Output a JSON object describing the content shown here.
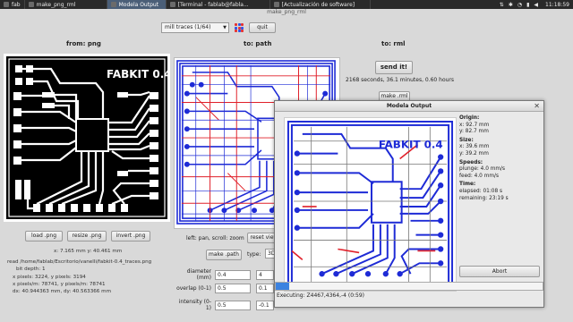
{
  "taskbar": {
    "tasks": [
      {
        "label": "fab",
        "active": false
      },
      {
        "label": "make_png_rml",
        "active": false
      },
      {
        "label": "Modela Output",
        "active": true
      },
      {
        "label": "[Terminal - fablab@fabla...",
        "active": false
      },
      {
        "label": "[Actualización de software]",
        "active": false
      }
    ],
    "clock": "11:18:59"
  },
  "app": {
    "title": "make_png_rml",
    "mode_select": "mill traces (1/64)",
    "quit_label": "quit"
  },
  "left": {
    "title": "from: png",
    "board_label": "FABKIT 0.4",
    "load_label": "load .png",
    "resize_label": "resize .png",
    "invert_label": "invert .png",
    "xy": "x: 7.165 mm  y: 40.461 mm",
    "read_path": "read /home/fablab/Escritorio/vanelli/fabkit-0.4_traces.png",
    "bit_depth": "bit depth: 1",
    "pixels": "x pixels: 3224, y pixels: 3194",
    "ppm": "x pixels/m: 78741, y pixels/m: 78741",
    "dxdy": "dx: 40.944363 mm, dy: 40.563366 mm"
  },
  "middle": {
    "title": "to: path",
    "nav_hint": "left: pan, scroll: zoom",
    "reset_label": "reset view",
    "make_path_label": "make .path",
    "type_label": "type:",
    "type_value": "3D",
    "diameter_label": "diameter (mm)",
    "diameter_value": "0.4",
    "diameter_value2": "4",
    "overlap_label": "overlap (0-1)",
    "overlap_value": "0.5",
    "overlap_value2": "0.1",
    "intensity_label": "intensity (0-1)",
    "intensity_value": "0.5",
    "intensity_value2": "-0.1"
  },
  "right": {
    "title": "to: rml",
    "send_label": "send it!",
    "stats": "2168 seconds, 36.1 minutes, 0.60 hours",
    "make_rml_label": "make .rml"
  },
  "dialog": {
    "title": "Modela Output",
    "board_label": "FABKIT 0.4",
    "origin_h": "Origin:",
    "origin_x": "x: 92.7 mm",
    "origin_y": "y: 82.7 mm",
    "size_h": "Size:",
    "size_x": "x: 39.6 mm",
    "size_y": "y: 39.2 mm",
    "speeds_h": "Speeds:",
    "plunge": "plunge: 4.0 mm/s",
    "feed": "feed: 4.0 mm/s",
    "time_h": "Time:",
    "elapsed": "elapsed: 01:08 s",
    "remaining": "remaining: 23:19 s",
    "abort_label": "Abort",
    "progress": 0.05,
    "status": "Executing: Z4467,4364,-4 (0:59)"
  },
  "colors": {
    "accent": "#3b82e0",
    "path_blue": "#1e2bd6",
    "path_red": "#e0202a"
  }
}
